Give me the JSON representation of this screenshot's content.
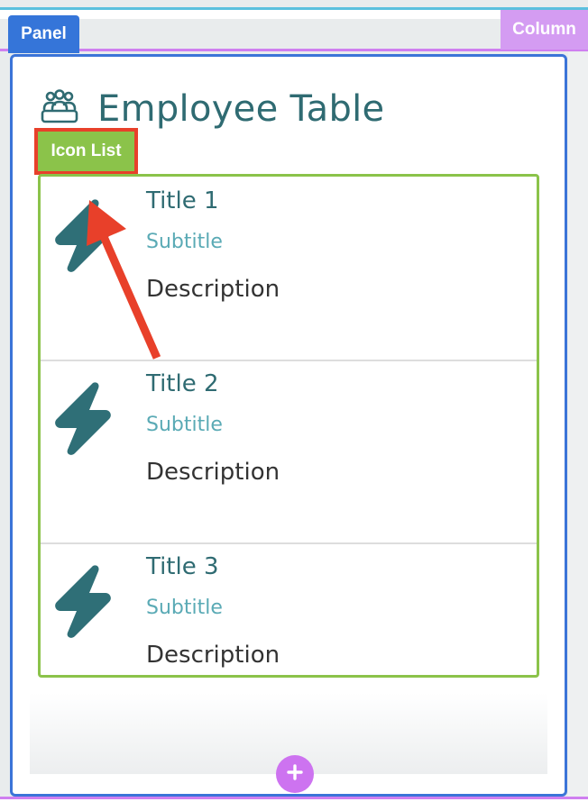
{
  "tags": {
    "column": "Column",
    "panel": "Panel",
    "icon_list": "Icon List"
  },
  "panel": {
    "title": "Employee Table",
    "title_icon": "people-group-icon"
  },
  "icon_list": {
    "item_icon": "lightning-bolt-icon",
    "items": [
      {
        "title": "Title 1",
        "subtitle": "Subtitle",
        "description": "Description"
      },
      {
        "title": "Title 2",
        "subtitle": "Subtitle",
        "description": "Description"
      },
      {
        "title": "Title 3",
        "subtitle": "Subtitle",
        "description": "Description"
      }
    ]
  },
  "add_button": {
    "icon": "plus-icon"
  },
  "colors": {
    "panel_border": "#3b74d8",
    "icon_list_border": "#8bc34a",
    "column_tag": "#d49cf2",
    "annotation_red": "#e8402a",
    "teal_text": "#2f6b72",
    "subtitle_teal": "#5aaab5",
    "add_button": "#cd73f0"
  }
}
